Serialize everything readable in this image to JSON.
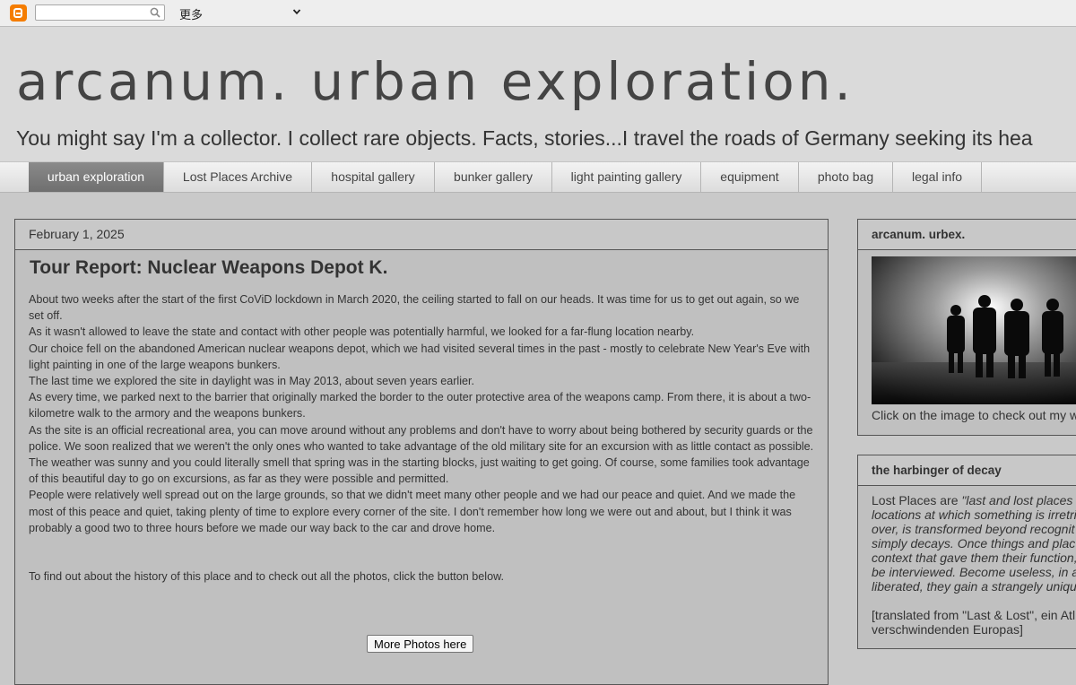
{
  "navbar": {
    "search_value": "",
    "more_label": "更多"
  },
  "header": {
    "title": "arcanum. urban exploration.",
    "description": "You might say I'm a collector. I collect rare objects. Facts, stories...I travel the roads of Germany seeking its hea"
  },
  "tabs": [
    {
      "label": "urban exploration",
      "active": true
    },
    {
      "label": "Lost Places Archive",
      "active": false
    },
    {
      "label": "hospital gallery",
      "active": false
    },
    {
      "label": "bunker gallery",
      "active": false
    },
    {
      "label": "light painting gallery",
      "active": false
    },
    {
      "label": "equipment",
      "active": false
    },
    {
      "label": "photo bag",
      "active": false
    },
    {
      "label": "legal info",
      "active": false
    }
  ],
  "post": {
    "date": "February 1, 2025",
    "title": "Tour Report: Nuclear Weapons Depot K.",
    "paragraphs": [
      "About two weeks after the start of the first CoViD lockdown in March 2020, the ceiling started to fall on our heads. It was time for us to get out again, so we set off.",
      "As it wasn't allowed to leave the state and contact with other people was potentially harmful, we looked for a far-flung location nearby.",
      "Our choice fell on the abandoned American nuclear weapons depot, which we had visited several times in the past - mostly to celebrate New Year's Eve with light painting in one of the large weapons bunkers.",
      "The last time we explored the site in daylight was in May 2013, about seven years earlier.",
      "As every time, we parked next to the barrier that originally marked the border to the outer protective area of the weapons camp. From there, it is about a two-kilometre walk to the armory and the weapons bunkers.",
      "As the site is an official recreational area, you can move around without any problems and don't have to worry about being bothered by security guards or the police. We soon realized that we weren't the only ones who wanted to take advantage of the old military site for an excursion with as little contact as possible.",
      "The weather was sunny and you could literally smell that spring was in the starting blocks, just waiting to get going. Of course, some families took advantage of this beautiful day to go on excursions, as far as they were possible and permitted.",
      "People were relatively well spread out on the large grounds, so that we didn't meet many other people and we had our peace and quiet. And we made the most of this peace and quiet, taking plenty of time to explore every corner of the site. I don't remember how long we were out and about, but I think it was probably a good two to three hours before we made our way back to the car and drove home."
    ],
    "cta_text": "To find out about the history of this place and to check out all the photos, click the button below.",
    "button_label": "More Photos here"
  },
  "sidebar": {
    "widget1": {
      "title": "arcanum. urbex.",
      "caption": "Click on the image to check out my w"
    },
    "widget2": {
      "title": "the harbinger of decay",
      "intro": "Lost Places are ",
      "quote": "\"last and lost places locations at which something is irretri over, is transformed beyond recognit simply decays. Once things and plac context that gave them their function, be interviewed. Become useless, in a liberated, they gain a strangely uniqu",
      "source": "[translated from \"Last & Lost\", ein Atl verschwindenden Europas]"
    }
  }
}
